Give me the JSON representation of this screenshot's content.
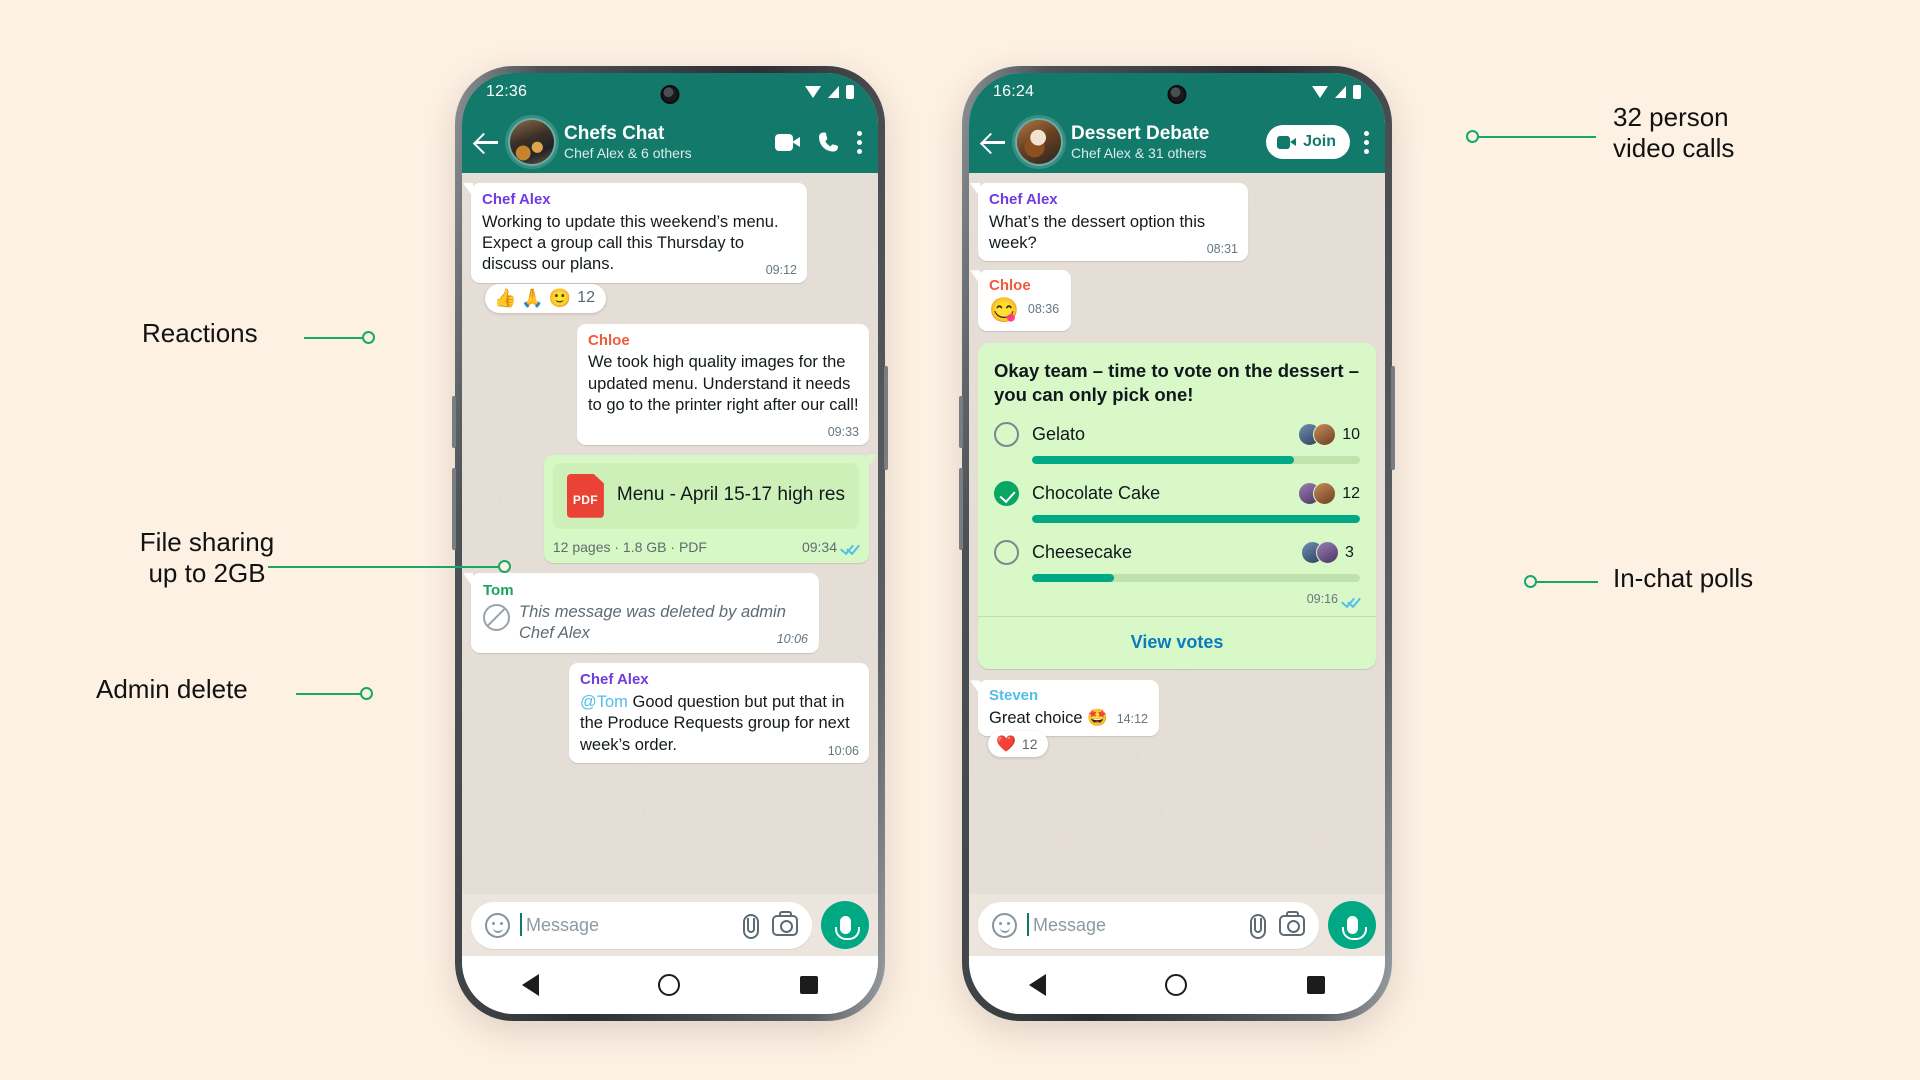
{
  "canvas": {
    "background": "#fdf1e4",
    "accent": "#17a866"
  },
  "phone_left": {
    "status": {
      "time": "12:36",
      "wifi_icon": "wifi-icon",
      "signal_icon": "signal-icon",
      "battery_icon": "battery-icon"
    },
    "header": {
      "back_icon": "back-arrow-icon",
      "avatar_icon": "group-avatar",
      "title": "Chefs Chat",
      "subtitle": "Chef Alex & 6 others",
      "video_icon": "video-call-icon",
      "call_icon": "voice-call-icon",
      "menu_icon": "overflow-menu-icon"
    },
    "messages": [
      {
        "sender": "Chef Alex",
        "sender_color": "#6f3ce0",
        "text": "Working to update this weekend’s menu. Expect a group call this Thursday to discuss our plans.",
        "time": "09:12",
        "reactions": {
          "emojis": "👍 🙏 🙂",
          "count": "12"
        }
      },
      {
        "sender": "Chloe",
        "sender_color": "#f05a3a",
        "text": "We took high quality images for the updated menu. Understand it needs to go to the printer right after our call!",
        "time": "09:33"
      },
      {
        "file_icon": "pdf-file-icon",
        "file_badge": "PDF",
        "filename": "Menu - April 15-17 high res",
        "file_meta": "12 pages · 1.8 GB · PDF",
        "time": "09:34",
        "ticks_icon": "read-receipt-double-check"
      },
      {
        "sender": "Tom",
        "sender_color": "#1aa35a",
        "deleted_icon": "blocked-circle-icon",
        "deleted_text": "This message was deleted by admin Chef Alex",
        "time": "10:06"
      },
      {
        "sender": "Chef Alex",
        "sender_color": "#6f3ce0",
        "mention": "@Tom",
        "text": " Good question but put that in the Produce Requests group for next week’s order.",
        "time": "10:06"
      }
    ],
    "composer": {
      "smiley_icon": "emoji-icon",
      "placeholder": "Message",
      "attach_icon": "paperclip-icon",
      "camera_icon": "camera-icon",
      "mic_icon": "microphone-icon"
    },
    "navbar": {
      "back_icon": "nav-back-icon",
      "home_icon": "nav-home-icon",
      "recents_icon": "nav-recents-icon"
    }
  },
  "phone_right": {
    "status": {
      "time": "16:24",
      "wifi_icon": "wifi-icon",
      "signal_icon": "signal-icon",
      "battery_icon": "battery-icon"
    },
    "header": {
      "back_icon": "back-arrow-icon",
      "avatar_icon": "group-avatar",
      "title": "Dessert Debate",
      "subtitle": "Chef Alex & 31 others",
      "join_label": "Join",
      "join_icon": "video-call-icon",
      "menu_icon": "overflow-menu-icon"
    },
    "messages": [
      {
        "sender": "Chef Alex",
        "sender_color": "#6f3ce0",
        "text": "What’s the dessert option this week?",
        "time": "08:31"
      },
      {
        "sender": "Chloe",
        "sender_color": "#f05a3a",
        "emoji": "😋",
        "time": "08:36"
      }
    ],
    "poll": {
      "question": "Okay team – time to vote on the dessert – you can only pick one!",
      "options": [
        {
          "label": "Gelato",
          "votes": "10",
          "percent": 80,
          "selected": false
        },
        {
          "label": "Chocolate Cake",
          "votes": "12",
          "percent": 100,
          "selected": true
        },
        {
          "label": "Cheesecake",
          "votes": "3",
          "percent": 25,
          "selected": false
        }
      ],
      "time": "09:16",
      "ticks_icon": "read-receipt-double-check",
      "view_votes_label": "View votes"
    },
    "last_message": {
      "sender": "Steven",
      "sender_color": "#53bdeb",
      "text": "Great choice 🤩",
      "time": "14:12",
      "reaction_emoji": "❤️",
      "reaction_count": "12"
    },
    "composer": {
      "smiley_icon": "emoji-icon",
      "placeholder": "Message",
      "attach_icon": "paperclip-icon",
      "camera_icon": "camera-icon",
      "mic_icon": "microphone-icon"
    },
    "navbar": {
      "back_icon": "nav-back-icon",
      "home_icon": "nav-home-icon",
      "recents_icon": "nav-recents-icon"
    }
  },
  "annotations": {
    "reactions": "Reactions",
    "file_sharing": "File sharing\nup to 2GB",
    "admin_delete": "Admin delete",
    "video_calls": "32 person\nvideo calls",
    "polls": "In-chat polls"
  }
}
